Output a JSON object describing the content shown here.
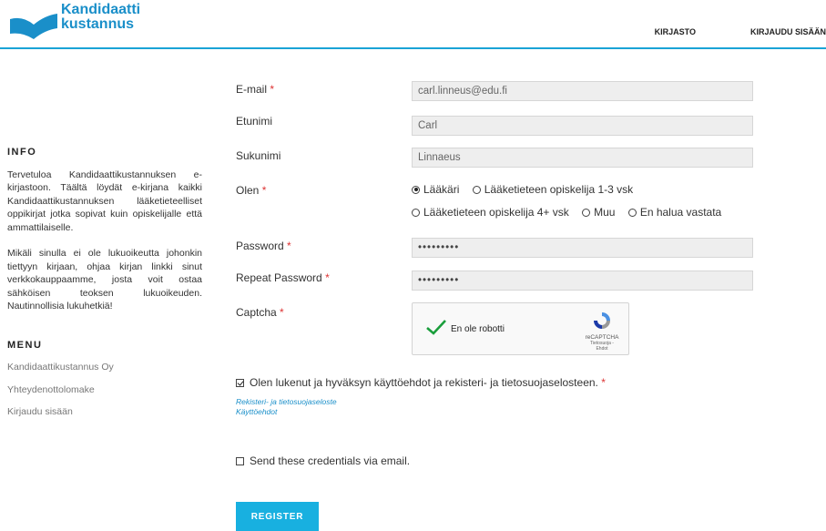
{
  "brand": {
    "line1": "Kandidaatti",
    "line2": "kustannus",
    "color": "#1a8fc9"
  },
  "nav": {
    "library": "KIRJASTO",
    "login": "KIRJAUDU SISÄÄN"
  },
  "sidebar": {
    "info_title": "INFO",
    "info_p1": "Tervetuloa Kandidaattikustannuksen e-kirjastoon. Täältä löydät e-kirjana kaikki Kandidaattikustannuksen lääketieteelliset oppikirjat jotka sopivat kuin opiskelijalle että ammattilaiselle.",
    "info_p2": "Mikäli sinulla ei ole lukuoikeutta johonkin tiettyyn kirjaan, ohjaa kirjan linkki sinut verkkokauppaamme, josta voit ostaa sähköisen teoksen lukuoikeuden. Nautinnollisia lukuhetkiä!",
    "menu_title": "MENU",
    "menu_items": [
      "Kandidaattikustannus Oy",
      "Yhteydenottolomake",
      "Kirjaudu sisään"
    ]
  },
  "form": {
    "email_label": "E-mail",
    "email_value": "carl.linneus@edu.fi",
    "firstname_label": "Etunimi",
    "firstname_value": "Carl",
    "lastname_label": "Sukunimi",
    "lastname_value": "Linnaeus",
    "role_label": "Olen",
    "role_options": [
      "Lääkäri",
      "Lääketieteen opiskelija 1-3 vsk",
      "Lääketieteen opiskelija 4+ vsk",
      "Muu",
      "En halua vastata"
    ],
    "role_selected": "Lääkäri",
    "password_label": "Password",
    "password_value": "•••••••••",
    "repeat_label": "Repeat Password",
    "repeat_value": "•••••••••",
    "captcha_label": "Captcha",
    "captcha_text": "En ole robotti",
    "captcha_brand": "reCAPTCHA",
    "captcha_links": "Tietosuoja - Ehdot",
    "required_mark": "*",
    "terms_text": "Olen lukenut ja hyväksyn käyttöehdot ja rekisteri- ja tietosuojaselosteen.",
    "terms_checked": true,
    "link_privacy": "Rekisteri- ja tietosuojaseloste",
    "link_terms": "Käyttöehdot",
    "send_credentials": "Send these credentials via email.",
    "send_checked": false,
    "register": "REGISTER"
  },
  "colors": {
    "accent": "#1aa3d6",
    "button": "#18b0e0",
    "required": "#dd3333",
    "check": "#1a9e3c"
  }
}
